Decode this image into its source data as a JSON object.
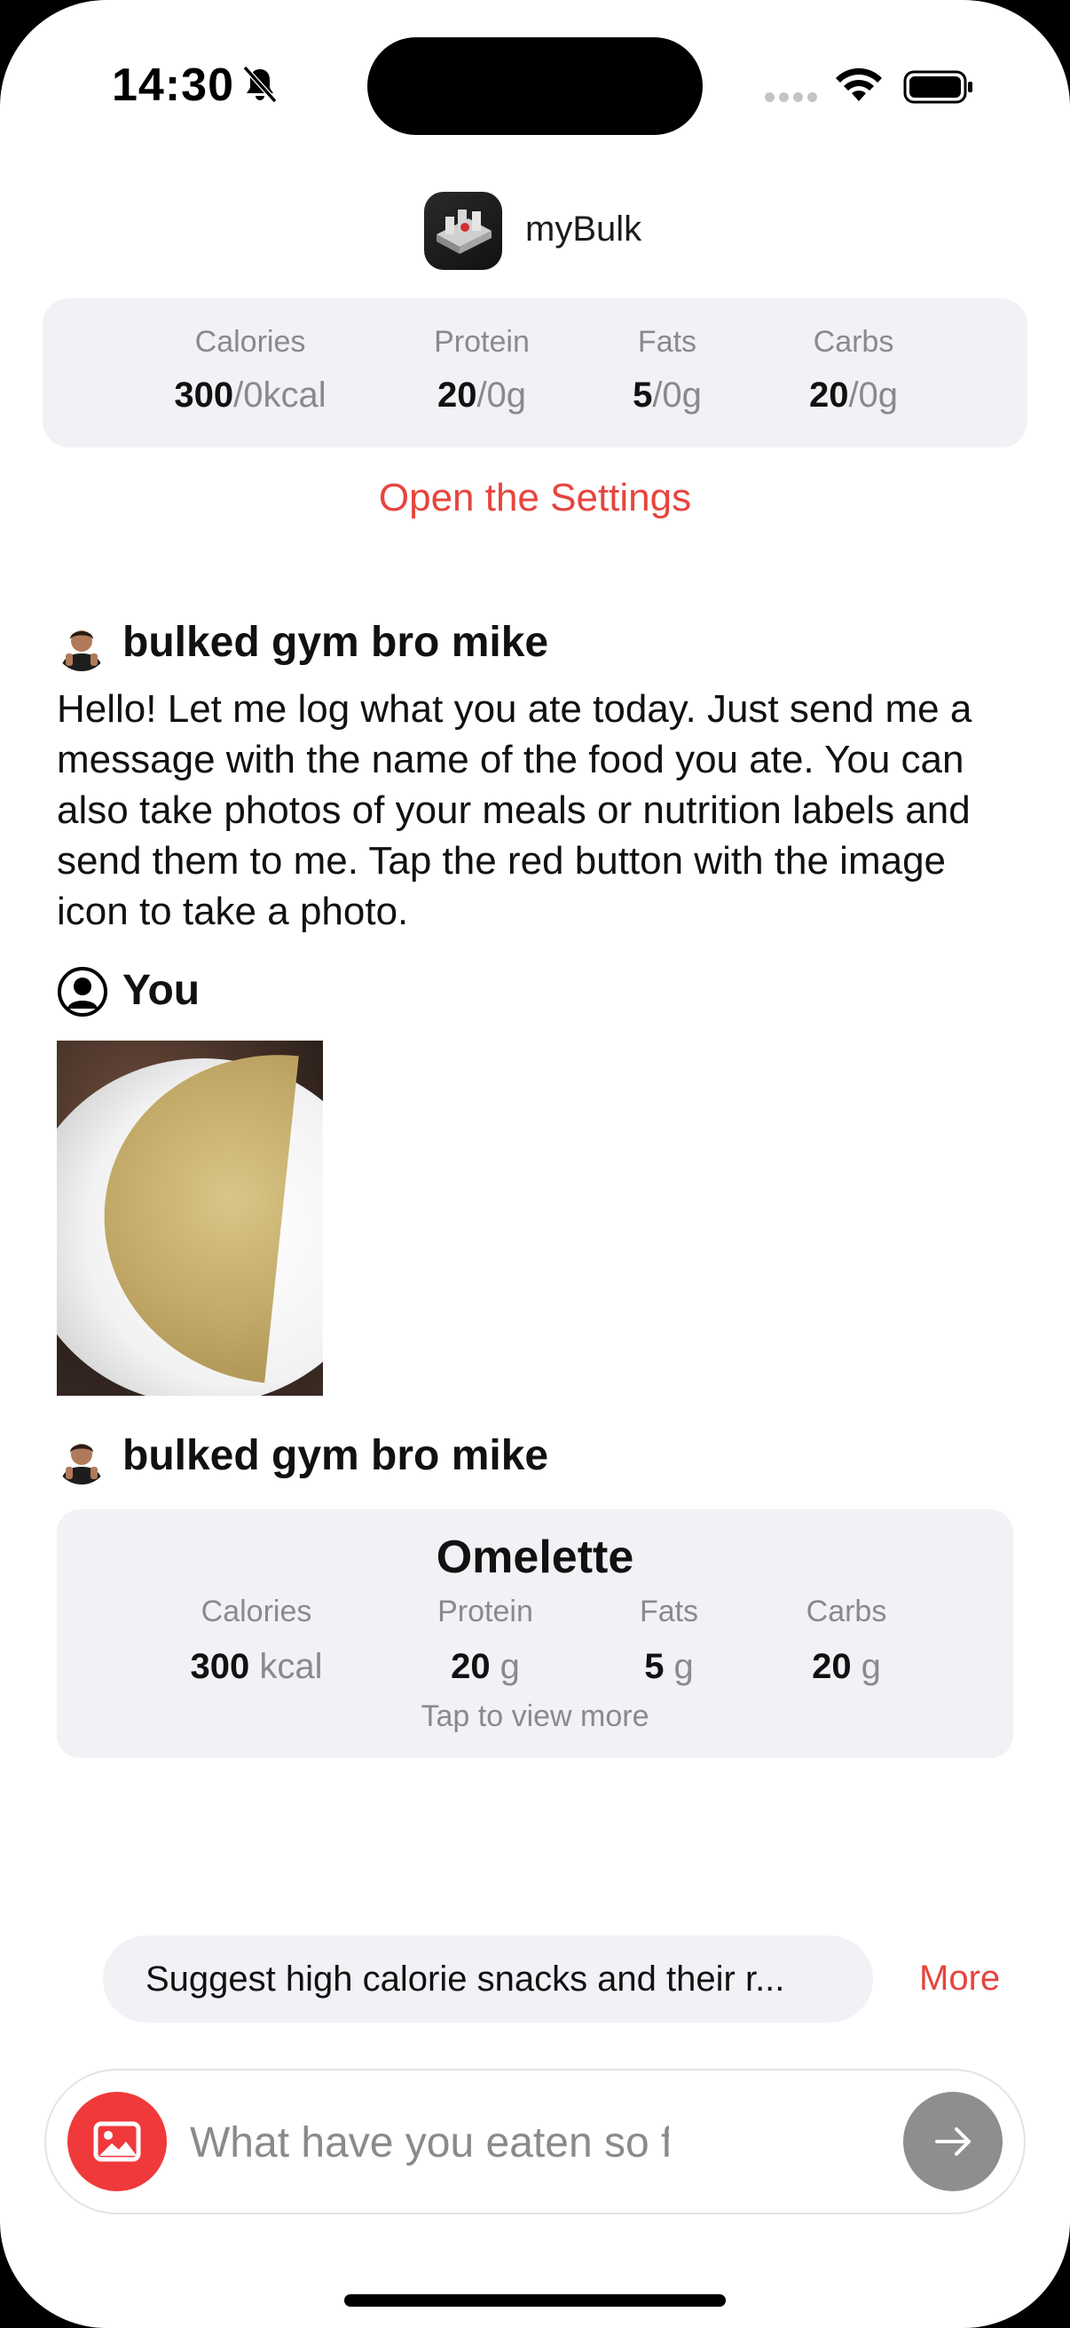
{
  "status_bar": {
    "time": "14:30"
  },
  "header": {
    "app_name": "myBulk"
  },
  "summary": {
    "calories_label": "Calories",
    "calories_value": "300",
    "calories_goal": "/0kcal",
    "protein_label": "Protein",
    "protein_value": "20",
    "protein_goal": "/0g",
    "fats_label": "Fats",
    "fats_value": "5",
    "fats_goal": "/0g",
    "carbs_label": "Carbs",
    "carbs_value": "20",
    "carbs_goal": "/0g"
  },
  "settings_link": "Open the Settings",
  "chat": {
    "bot_name": "bulked gym bro mike",
    "welcome_message": "Hello! Let me log what you ate today. Just send me a message with the name of the food you ate. You can also take photos of your meals or nutrition labels and send them to me. Tap the red button with the image icon to take a photo.",
    "user_name": "You",
    "food_card": {
      "title": "Omelette",
      "calories_label": "Calories",
      "calories_value": "300",
      "calories_unit": " kcal",
      "protein_label": "Protein",
      "protein_value": "20",
      "protein_unit": " g",
      "fats_label": "Fats",
      "fats_value": "5",
      "fats_unit": " g",
      "carbs_label": "Carbs",
      "carbs_value": "20",
      "carbs_unit": " g",
      "tap_hint": "Tap to view more"
    }
  },
  "suggestion": {
    "text": "Suggest high calorie snacks and their r...",
    "more_label": "More"
  },
  "input": {
    "placeholder": "What have you eaten so far?",
    "value": ""
  },
  "colors": {
    "accent": "#e6453d",
    "photo_button": "#f0393b",
    "card_bg": "#f1f1f6",
    "send_button": "#8e8e8e"
  },
  "icons": [
    "bell-slash-icon",
    "wifi-icon",
    "battery-icon",
    "app-icon",
    "bot-avatar-icon",
    "user-circle-icon",
    "image-icon",
    "arrow-right-icon"
  ]
}
